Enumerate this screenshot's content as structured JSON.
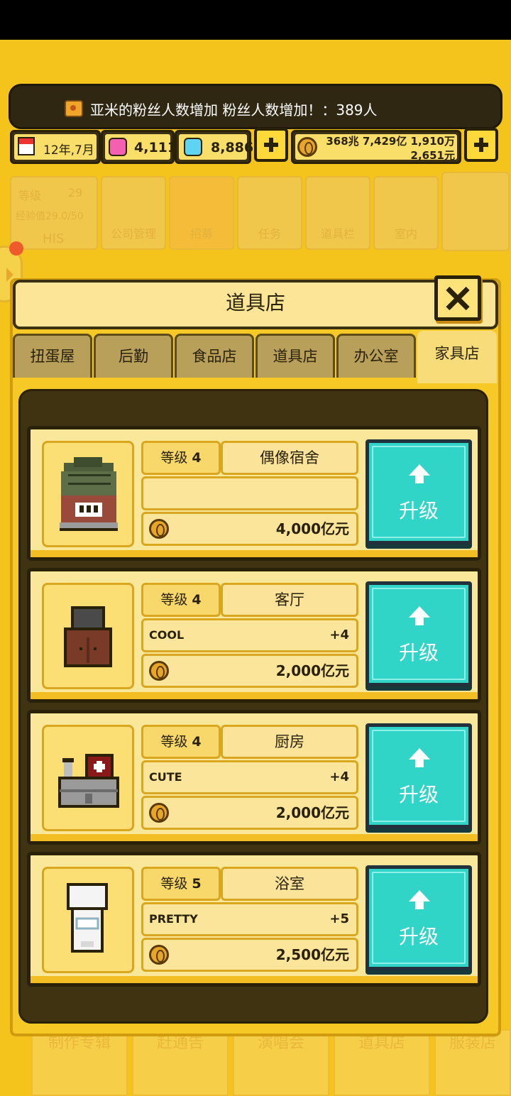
{
  "notification": {
    "text": "亚米的粉丝人数增加 粉丝人数增加！：389人"
  },
  "resources": {
    "date": "12年,7月",
    "pink_gems": "4,111",
    "blue_gems": "8,886",
    "money_line1": "368兆 7,429亿 1,910万",
    "money_line2": "2,651元"
  },
  "background_menu": {
    "level_label": "等级",
    "level_value": "29",
    "exp": "经验值29.0/50",
    "name": "HIS",
    "items": [
      "公司管理",
      "招募",
      "任务",
      "道具栏",
      "室内"
    ],
    "bottom_items": [
      "制作专辑",
      "赶通告",
      "演唱会",
      "道具店",
      "服装店"
    ]
  },
  "dialog": {
    "title": "道具店",
    "tabs": [
      "扭蛋屋",
      "后勤",
      "食品店",
      "道具店",
      "办公室",
      "家具店"
    ],
    "active_tab": "家具店"
  },
  "items": [
    {
      "level_label": "等级",
      "level": "4",
      "name": "偶像宿舍",
      "stat": "",
      "stat_value": "",
      "price": "4,000亿元",
      "button": "升级",
      "icon": "dorm-icon"
    },
    {
      "level_label": "等级",
      "level": "4",
      "name": "客厅",
      "stat": "COOL",
      "stat_value": "+4",
      "price": "2,000亿元",
      "button": "升级",
      "icon": "tv-cabinet-icon"
    },
    {
      "level_label": "等级",
      "level": "4",
      "name": "厨房",
      "stat": "CUTE",
      "stat_value": "+4",
      "price": "2,000亿元",
      "button": "升级",
      "icon": "kitchen-stove-icon"
    },
    {
      "level_label": "等级",
      "level": "5",
      "name": "浴室",
      "stat": "PRETTY",
      "stat_value": "+5",
      "price": "2,500亿元",
      "button": "升级",
      "icon": "toilet-icon"
    }
  ],
  "colors": {
    "background": "#f4c31c",
    "upgrade_button": "#30d5c7",
    "panel_dark": "#3f3312"
  }
}
